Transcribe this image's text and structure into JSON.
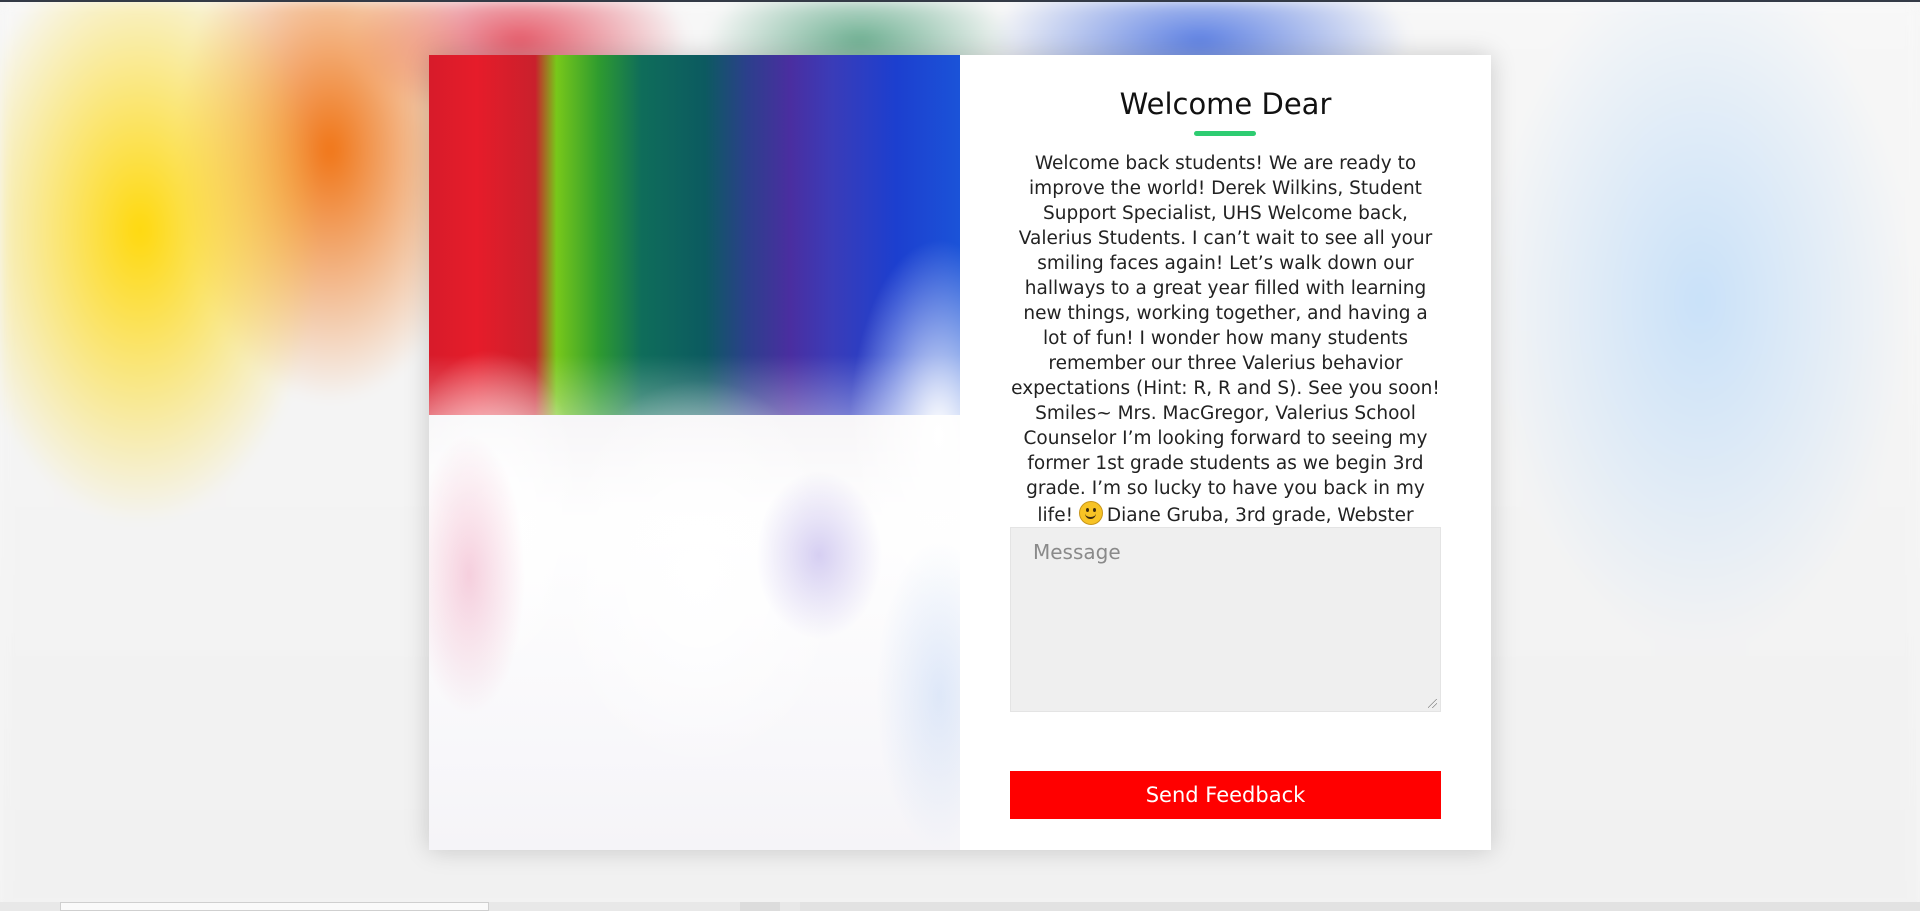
{
  "form": {
    "title": "Welcome Dear",
    "accent_color": "#2ecc71",
    "message_text_before_emoji": "Welcome back students! We are ready to improve the world! Derek Wilkins, Student Support Specialist, UHS Welcome back, Valerius Students. I can’t wait to see all your smiling faces again! Let’s walk down our hallways to a great year filled with learning new things, working together, and having a lot of fun! I wonder how many students remember our three Valerius behavior expectations (Hint: R, R and S). See you soon! Smiles~ Mrs. MacGregor, Valerius School Counselor I’m looking forward to seeing my former 1st grade students as we begin 3rd grade. I’m so lucky to have you back in my life!",
    "emoji": "smiling-face-icon",
    "message_text_after_emoji": "Diane Gruba, 3rd grade, Webster",
    "textarea_placeholder": "Message",
    "submit_label": "Send Feedback",
    "submit_color": "#ff0000"
  }
}
